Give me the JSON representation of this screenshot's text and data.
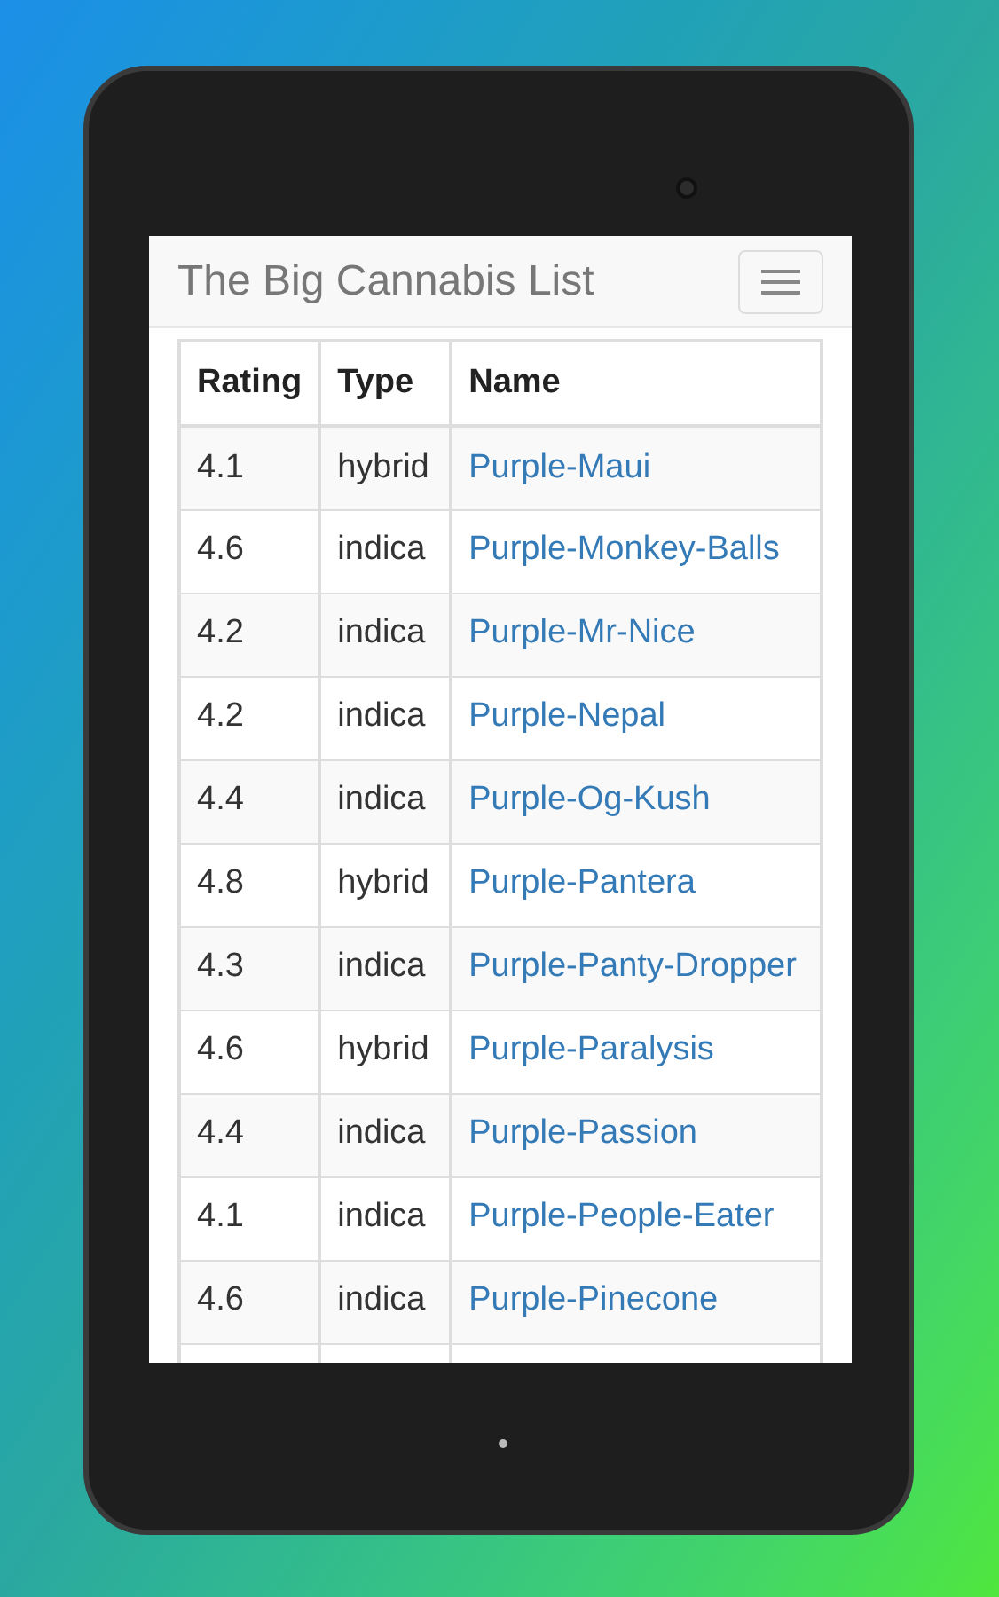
{
  "app_bar": {
    "title": "The Big Cannabis List"
  },
  "table": {
    "columns": [
      "Rating",
      "Type",
      "Name"
    ],
    "rows": [
      {
        "rating": "4.1",
        "type": "hybrid",
        "name": "Purple-Maui"
      },
      {
        "rating": "4.6",
        "type": "indica",
        "name": "Purple-Monkey-Balls"
      },
      {
        "rating": "4.2",
        "type": "indica",
        "name": "Purple-Mr-Nice"
      },
      {
        "rating": "4.2",
        "type": "indica",
        "name": "Purple-Nepal"
      },
      {
        "rating": "4.4",
        "type": "indica",
        "name": "Purple-Og-Kush"
      },
      {
        "rating": "4.8",
        "type": "hybrid",
        "name": "Purple-Pantera"
      },
      {
        "rating": "4.3",
        "type": "indica",
        "name": "Purple-Panty-Dropper"
      },
      {
        "rating": "4.6",
        "type": "hybrid",
        "name": "Purple-Paralysis"
      },
      {
        "rating": "4.4",
        "type": "indica",
        "name": "Purple-Passion"
      },
      {
        "rating": "4.1",
        "type": "indica",
        "name": "Purple-People-Eater"
      },
      {
        "rating": "4.6",
        "type": "indica",
        "name": "Purple-Pinecone"
      }
    ]
  }
}
